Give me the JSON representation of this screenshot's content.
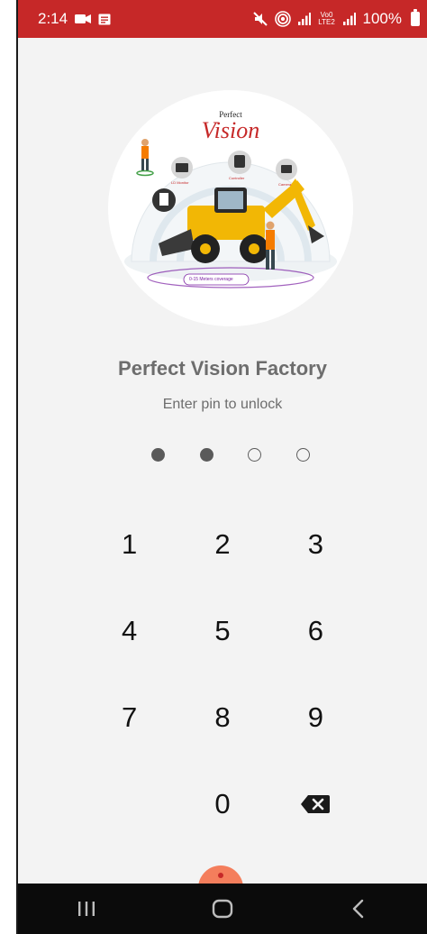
{
  "status_bar": {
    "time": "2:14",
    "network": "Vo0 LTE2",
    "battery": "100%",
    "bar_color": "#c62828"
  },
  "logo": {
    "small": "Perfect",
    "big": "Vision",
    "labels": {
      "monitor": "LD Monitor",
      "controller": "Controller",
      "camera": "Camera",
      "tag": "TAG",
      "coverage": "0-15 Meters coverage"
    }
  },
  "app": {
    "title": "Perfect Vision Factory",
    "subtitle": "Enter pin to unlock"
  },
  "pin": {
    "length": 4,
    "filled": 2
  },
  "keypad": {
    "keys": [
      "1",
      "2",
      "3",
      "4",
      "5",
      "6",
      "7",
      "8",
      "9",
      "",
      "0",
      "backspace"
    ]
  },
  "colors": {
    "accent": "#c62828",
    "background": "#f3f3f3",
    "text_muted": "#6d6d6d",
    "fab": "#f47e5c"
  },
  "icons": {
    "status_left": [
      "video-record-icon",
      "message-icon"
    ],
    "status_right": [
      "mute-icon",
      "hotspot-icon",
      "signal-icon",
      "signal-icon",
      "battery-icon"
    ],
    "nav": [
      "recents-icon",
      "home-icon",
      "back-icon"
    ]
  }
}
